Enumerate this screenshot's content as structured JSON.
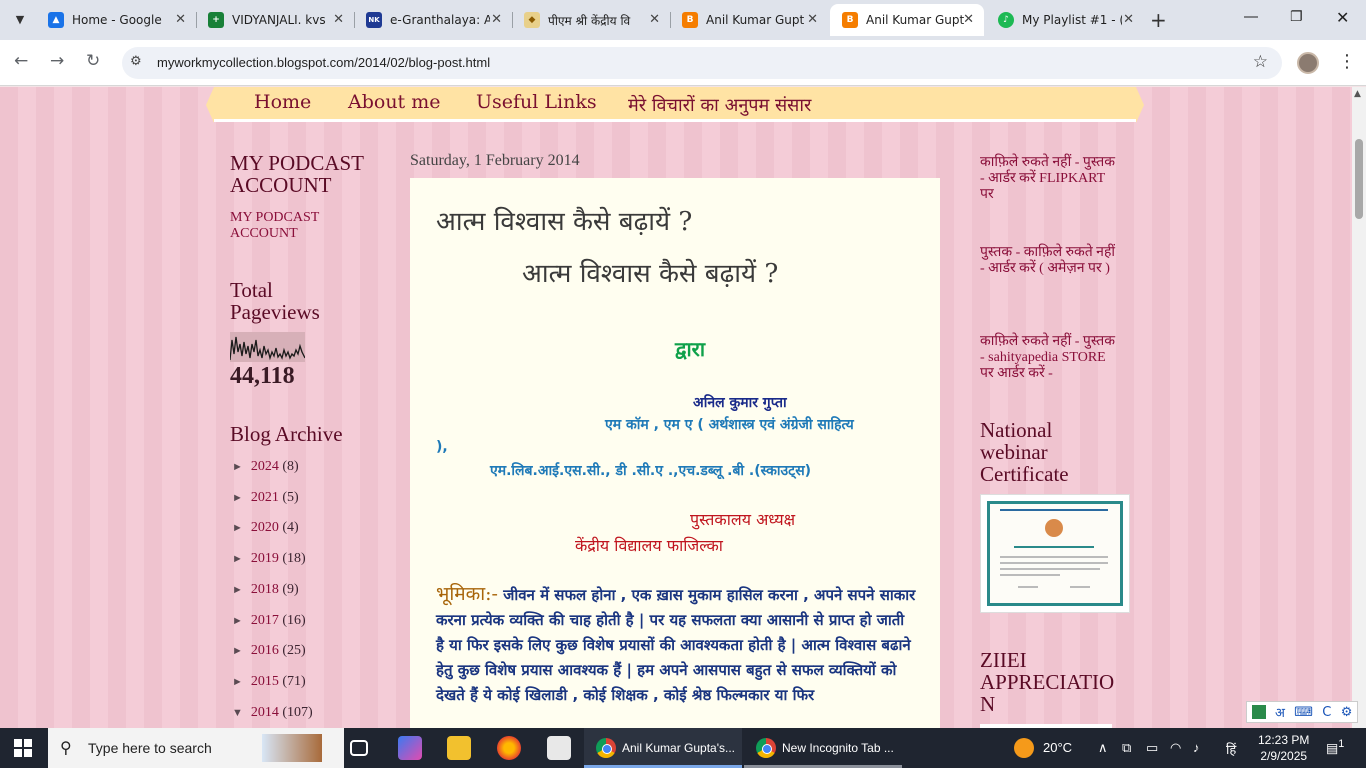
{
  "browser": {
    "tabs": [
      {
        "label": "Home - Google",
        "favicon_color": "#1a73e8",
        "favicon_text": "▲"
      },
      {
        "label": "VIDYANJALI. kvs",
        "favicon_color": "#188038",
        "favicon_text": "+"
      },
      {
        "label": "e-Granthalaya: A",
        "favicon_color": "#1f3a93",
        "favicon_text": "NK"
      },
      {
        "label": "पीएम श्री केंद्रीय वि",
        "favicon_color": "#e8d08a",
        "favicon_text": "◆"
      },
      {
        "label": "Anil Kumar Gupt",
        "favicon_color": "#f57d00",
        "favicon_text": "B"
      },
      {
        "label": "Anil Kumar Gupt",
        "favicon_color": "#f57d00",
        "favicon_text": "B"
      },
      {
        "label": "My Playlist #1 - (",
        "favicon_color": "#1db954",
        "favicon_text": "♪"
      }
    ],
    "url": "myworkmycollection.blogspot.com/2014/02/blog-post.html"
  },
  "nav": {
    "home": "Home",
    "about": "About me",
    "useful": "Useful Links",
    "hindi": "मेरे विचारों का अनुपम संसार"
  },
  "sidebar": {
    "podcast_title_1": "MY PODCAST",
    "podcast_title_2": "ACCOUNT",
    "podcast_link_1": "MY PODCAST",
    "podcast_link_2": "ACCOUNT",
    "pageviews_title_1": "Total",
    "pageviews_title_2": "Pageviews",
    "pageviews_count": "44,118",
    "archive_title": "Blog Archive",
    "archive": [
      {
        "arrow": "►",
        "year": "2024",
        "count": "(8)"
      },
      {
        "arrow": "►",
        "year": "2021",
        "count": "(5)"
      },
      {
        "arrow": "►",
        "year": "2020",
        "count": "(4)"
      },
      {
        "arrow": "►",
        "year": "2019",
        "count": "(18)"
      },
      {
        "arrow": "►",
        "year": "2018",
        "count": "(9)"
      },
      {
        "arrow": "►",
        "year": "2017",
        "count": "(16)"
      },
      {
        "arrow": "►",
        "year": "2016",
        "count": "(25)"
      },
      {
        "arrow": "►",
        "year": "2015",
        "count": "(71)"
      },
      {
        "arrow": "▼",
        "year": "2014",
        "count": "(107)"
      }
    ]
  },
  "post": {
    "date": "Saturday, 1 February 2014",
    "title": "आत्म विश्वास कैसे बढ़ायें ?",
    "subtitle": "आत्म विश्वास कैसे बढ़ायें ?",
    "by": "द्वारा",
    "author": "अनिल कुमार गुप्ता",
    "quals_line1": "एम कॉम , एम ए ( अर्थशास्त्र एवं अंग्रेजी साहित्य",
    "quals_line1b": "),",
    "quals_line2": "एम.लिब.आई.एस.सी., डी .सी.ए .,एच.डब्लू .बी .(स्काउट्स)",
    "role": "पुस्तकालय अध्यक्ष",
    "school": "केंद्रीय विद्यालय फाजिल्का",
    "intro_head": "भूमिका:-",
    "intro_body": " जीवन में सफल होना , एक ख़ास मुकाम हासिल करना , अपने सपने साकार करना प्रत्येक व्यक्ति की चाह होती है | पर यह सफलता क्या आसानी से प्राप्त हो जाती है या फिर इसके लिए कुछ विशेष प्रयासों की आवश्यकता होती है | आत्म विश्वास बढाने हेतु कुछ विशेष प्रयास आवश्यक हैं | हम अपने आसपास बहुत से सफल व्यक्तियों को देखते हैं ये कोई खिलाडी , कोई शिक्षक , कोई श्रेष्ठ फिल्मकार या फिर"
  },
  "right": {
    "link1": "काफ़िले रुकते नहीं - पुस्तक - आर्डर करें FLIPKART पर",
    "link2": "पुस्तक - काफ़िले रुकते नहीं - आर्डर करें ( अमेज़न पर )",
    "link3": "काफ़िले रुकते नहीं - पुस्तक - sahityapedia STORE पर आर्डर करें -",
    "webinar_title": "National webinar Certificate",
    "ziiei_title": "ZIIEI APPRECIATIO N"
  },
  "ime": {
    "script": "अ",
    "mode": "C"
  },
  "taskbar": {
    "search_placeholder": "Type here to search",
    "app1": "Anil Kumar Gupta's...",
    "app2": "New Incognito Tab ...",
    "weather": "20°C",
    "lang": "हिं",
    "time": "12:23 PM",
    "date": "2/9/2025",
    "notif_count": "1"
  }
}
